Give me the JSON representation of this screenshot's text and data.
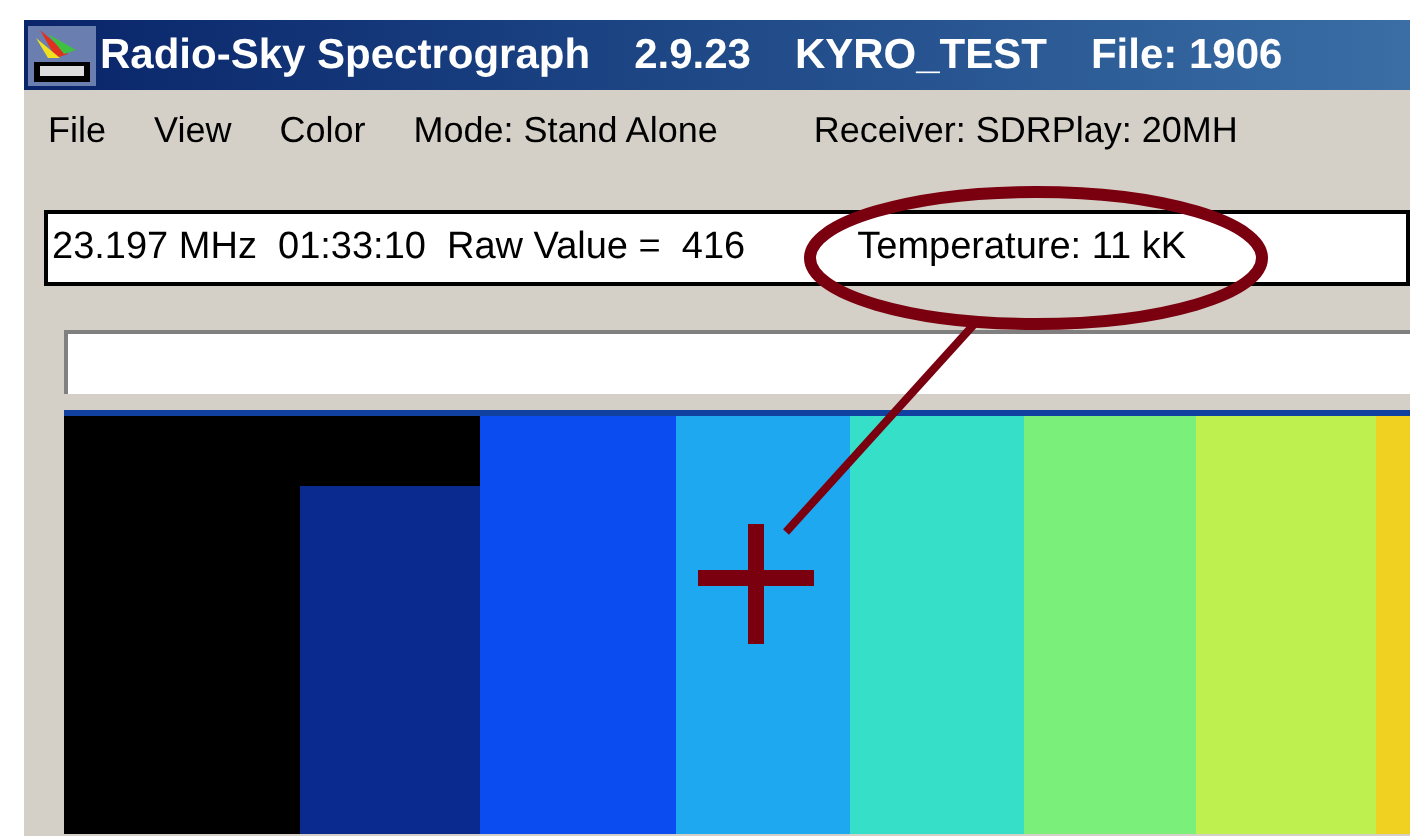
{
  "window": {
    "title_parts": [
      "Radio-Sky Spectrograph",
      "2.9.23",
      "KYRO_TEST",
      "File: 1906"
    ]
  },
  "menu": {
    "items": [
      "File",
      "View",
      "Color"
    ],
    "mode": "Mode: Stand Alone",
    "receiver": "Receiver:  SDRPlay: 20MH"
  },
  "status_field": {
    "reading": "23.197 MHz  01:33:10  Raw Value =  416",
    "temperature": "Temperature: 11 kK"
  }
}
